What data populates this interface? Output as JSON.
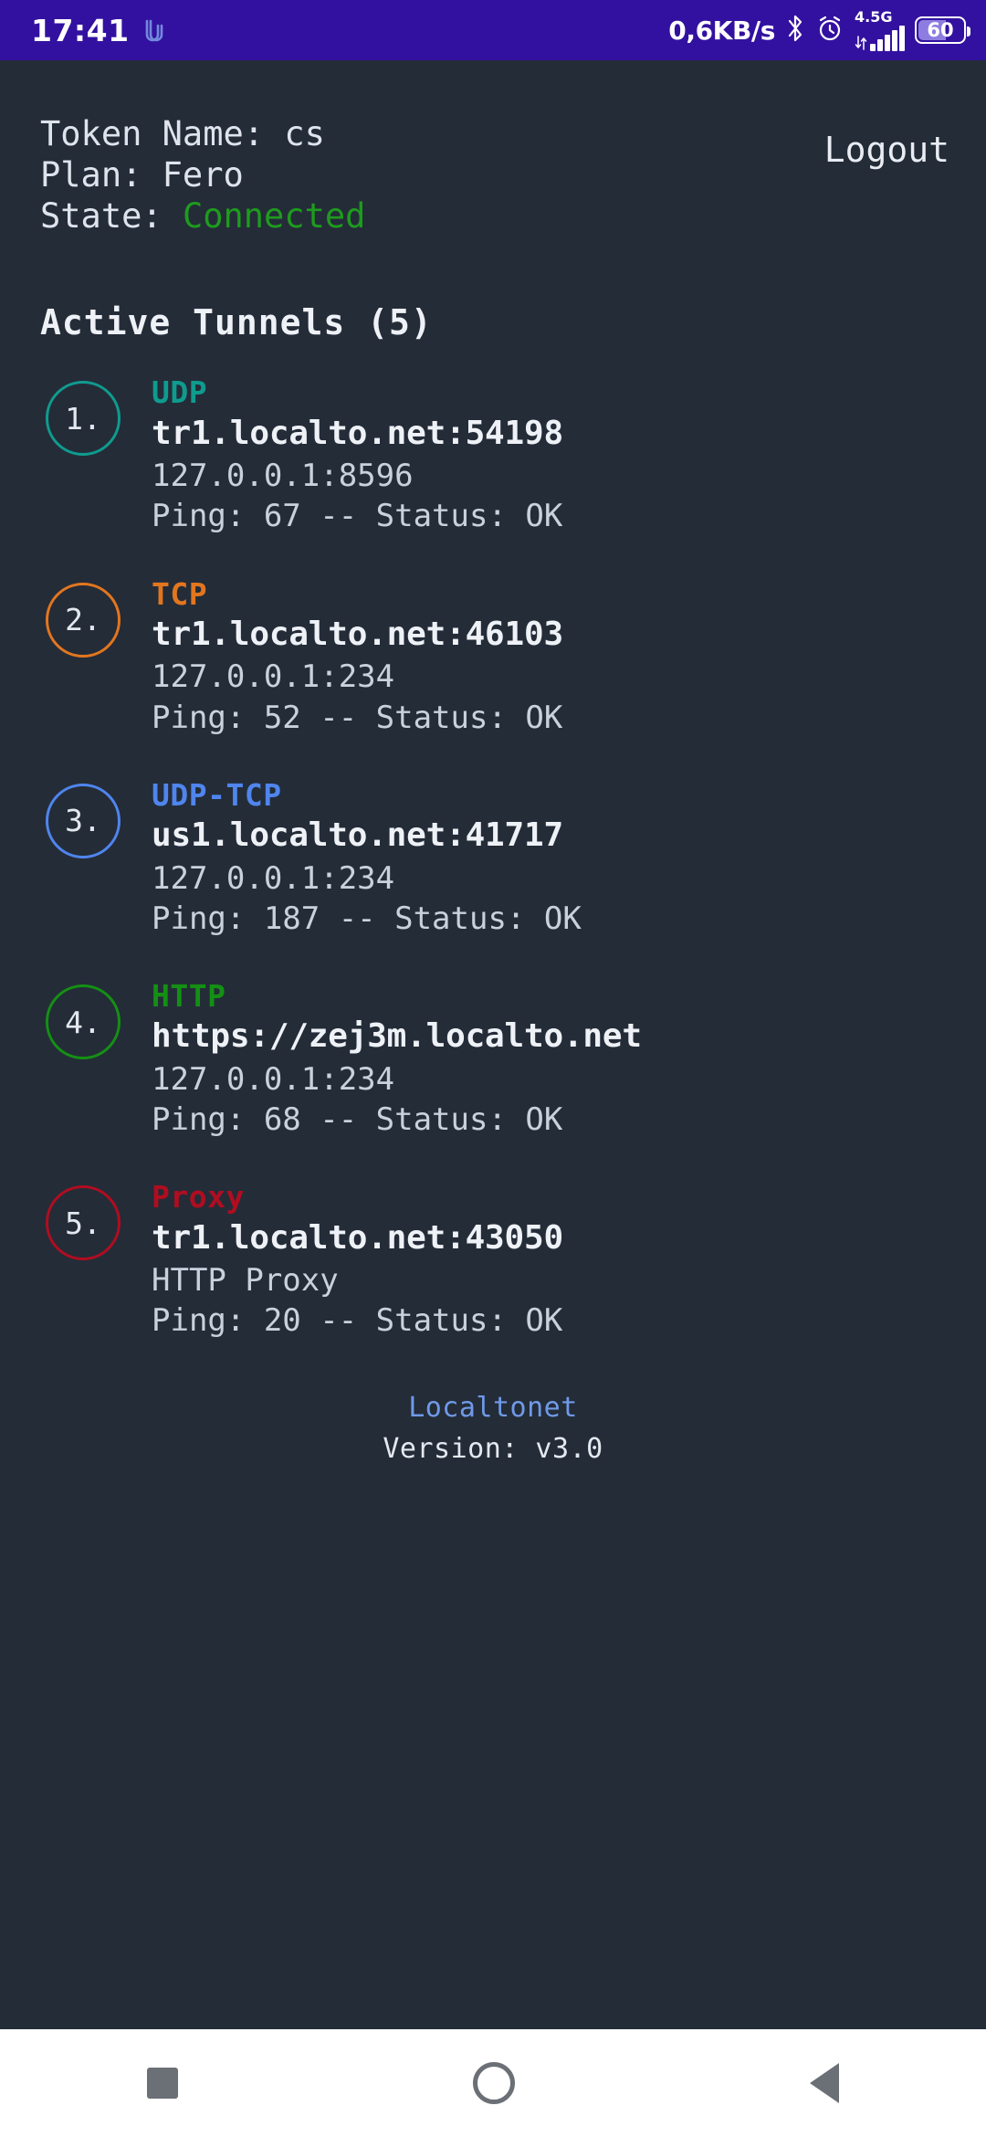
{
  "statusbar": {
    "clock": "17:41",
    "app_logo_icon": "localtonet-logo-icon",
    "network_speed": "0,6KB/s",
    "bluetooth_icon": "bluetooth-icon",
    "alarm_icon": "alarm-clock-icon",
    "network_generation": "4.5G",
    "signal_icon": "signal-bars-icon",
    "battery_level": "60",
    "battery_icon": "battery-icon"
  },
  "header": {
    "token_label": "Token Name: ",
    "token_value": "cs",
    "plan_label": "Plan: ",
    "plan_value": "Fero",
    "state_label": "State: ",
    "state_value": "Connected",
    "state_color": "#1e9b1e",
    "logout_label": "Logout"
  },
  "section": {
    "title": "Active Tunnels (5)"
  },
  "tunnels": [
    {
      "index": "1.",
      "protocol": "UDP",
      "color": "#0f9b8e",
      "remote": "tr1.localto.net:54198",
      "local": "127.0.0.1:8596",
      "ping": "Ping: 67 -- Status: OK"
    },
    {
      "index": "2.",
      "protocol": "TCP",
      "color": "#e2761f",
      "remote": "tr1.localto.net:46103",
      "local": "127.0.0.1:234",
      "ping": "Ping: 52 -- Status: OK"
    },
    {
      "index": "3.",
      "protocol": "UDP-TCP",
      "color": "#4f85ed",
      "remote": "us1.localto.net:41717",
      "local": "127.0.0.1:234",
      "ping": "Ping: 187 -- Status: OK"
    },
    {
      "index": "4.",
      "protocol": "HTTP",
      "color": "#149014",
      "remote": "https://zej3m.localto.net",
      "local": "127.0.0.1:234",
      "ping": "Ping: 68 -- Status: OK"
    },
    {
      "index": "5.",
      "protocol": "Proxy",
      "color": "#b00d20",
      "remote": "tr1.localto.net:43050",
      "local": "HTTP Proxy",
      "ping": "Ping: 20 -- Status: OK"
    }
  ],
  "footer": {
    "link_label": "Localtonet",
    "version": "Version: v3.0"
  },
  "navbar": {
    "recents_icon": "square-recents-icon",
    "home_icon": "circle-home-icon",
    "back_icon": "triangle-back-icon"
  }
}
